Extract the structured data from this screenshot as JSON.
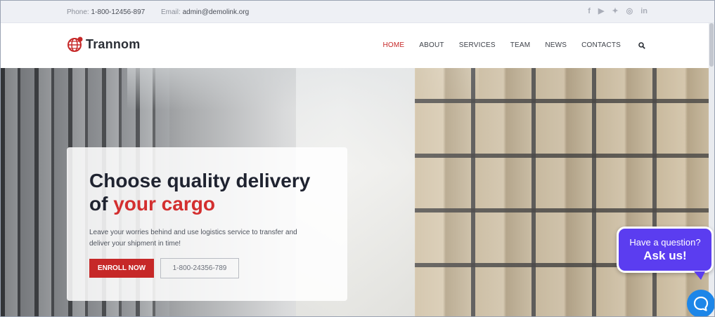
{
  "topbar": {
    "phone_label": "Phone:",
    "phone_value": "1-800-12456-897",
    "email_label": "Email:",
    "email_value": "admin@demolink.org",
    "socials": [
      {
        "icon": "facebook-icon",
        "glyph": "f"
      },
      {
        "icon": "youtube-icon",
        "glyph": "▶"
      },
      {
        "icon": "twitter-icon",
        "glyph": "✦"
      },
      {
        "icon": "instagram-icon",
        "glyph": "◎"
      },
      {
        "icon": "linkedin-icon",
        "glyph": "in"
      }
    ]
  },
  "header": {
    "brand": "Trannom",
    "nav": [
      "HOME",
      "ABOUT",
      "SERVICES",
      "TEAM",
      "NEWS",
      "CONTACTS"
    ],
    "active_nav": "HOME"
  },
  "hero": {
    "title_line1": "Choose quality delivery",
    "title_prefix": "of",
    "title_accent": "your cargo",
    "description": "Leave your worries behind and use logistics service to transfer and deliver your shipment in time!",
    "primary_button": "ENROLL NOW",
    "secondary_button": "1-800-24356-789"
  },
  "chat": {
    "question": "Have a question?",
    "cta": "Ask us!"
  },
  "colors": {
    "accent": "#c62828",
    "chat_purple": "#5b3df0",
    "chat_blue": "#1d86e8"
  }
}
